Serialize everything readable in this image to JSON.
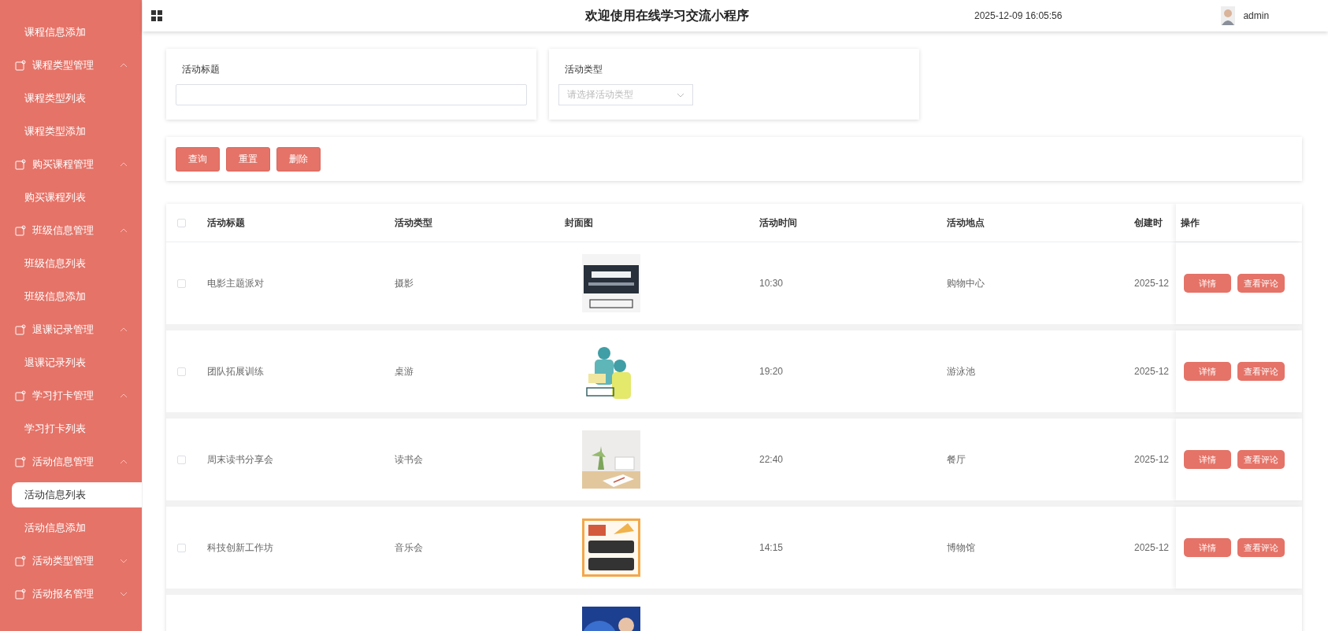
{
  "sidebar": {
    "items": [
      {
        "label": "课程信息添加",
        "kind": "link",
        "selected": false
      },
      {
        "label": "课程类型管理",
        "kind": "group",
        "expanded": true
      },
      {
        "label": "课程类型列表",
        "kind": "link",
        "selected": false
      },
      {
        "label": "课程类型添加",
        "kind": "link",
        "selected": false
      },
      {
        "label": "购买课程管理",
        "kind": "group",
        "expanded": true
      },
      {
        "label": "购买课程列表",
        "kind": "link",
        "selected": false
      },
      {
        "label": "班级信息管理",
        "kind": "group",
        "expanded": true
      },
      {
        "label": "班级信息列表",
        "kind": "link",
        "selected": false
      },
      {
        "label": "班级信息添加",
        "kind": "link",
        "selected": false
      },
      {
        "label": "退课记录管理",
        "kind": "group",
        "expanded": true
      },
      {
        "label": "退课记录列表",
        "kind": "link",
        "selected": false
      },
      {
        "label": "学习打卡管理",
        "kind": "group",
        "expanded": true
      },
      {
        "label": "学习打卡列表",
        "kind": "link",
        "selected": false
      },
      {
        "label": "活动信息管理",
        "kind": "group",
        "expanded": true
      },
      {
        "label": "活动信息列表",
        "kind": "link",
        "selected": true
      },
      {
        "label": "活动信息添加",
        "kind": "link",
        "selected": false
      },
      {
        "label": "活动类型管理",
        "kind": "group",
        "expanded": false
      },
      {
        "label": "活动报名管理",
        "kind": "group",
        "expanded": false
      }
    ]
  },
  "header": {
    "title": "欢迎使用在线学习交流小程序",
    "datetime": "2025-12-09 16:05:56",
    "user": "admin"
  },
  "filters": [
    {
      "label": "活动标题",
      "kind": "input"
    },
    {
      "label": "活动类型",
      "kind": "select",
      "placeholder": "请选择活动类型"
    }
  ],
  "actions": [
    "查询",
    "重置",
    "删除"
  ],
  "table": {
    "select_all": {
      "checked": false
    },
    "columns": [
      "活动标题",
      "活动类型",
      "封面图",
      "活动时间",
      "活动地点",
      "创建时",
      "操作"
    ],
    "rows": [
      {
        "checked": false,
        "title": "电影主题派对",
        "type": "摄影",
        "cover": {
          "kind": "picture"
        },
        "time": "10:30",
        "place": "购物中心",
        "created": "2025-12",
        "buttons": [
          "详情",
          "查看评论"
        ]
      },
      {
        "checked": false,
        "title": "团队拓展训练",
        "type": "桌游",
        "cover": {
          "kind": "picture"
        },
        "time": "19:20",
        "place": "游泳池",
        "created": "2025-12",
        "buttons": [
          "详情",
          "查看评论"
        ]
      },
      {
        "checked": false,
        "title": "周末读书分享会",
        "type": "读书会",
        "cover": {
          "kind": "picture"
        },
        "time": "22:40",
        "place": "餐厅",
        "created": "2025-12",
        "buttons": [
          "详情",
          "查看评论"
        ]
      },
      {
        "checked": false,
        "title": "科技创新工作坊",
        "type": "音乐会",
        "cover": {
          "kind": "picture"
        },
        "time": "14:15",
        "place": "博物馆",
        "created": "2025-12",
        "buttons": [
          "详情",
          "查看评论"
        ]
      },
      {
        "cover": {
          "kind": "picture"
        }
      }
    ]
  }
}
